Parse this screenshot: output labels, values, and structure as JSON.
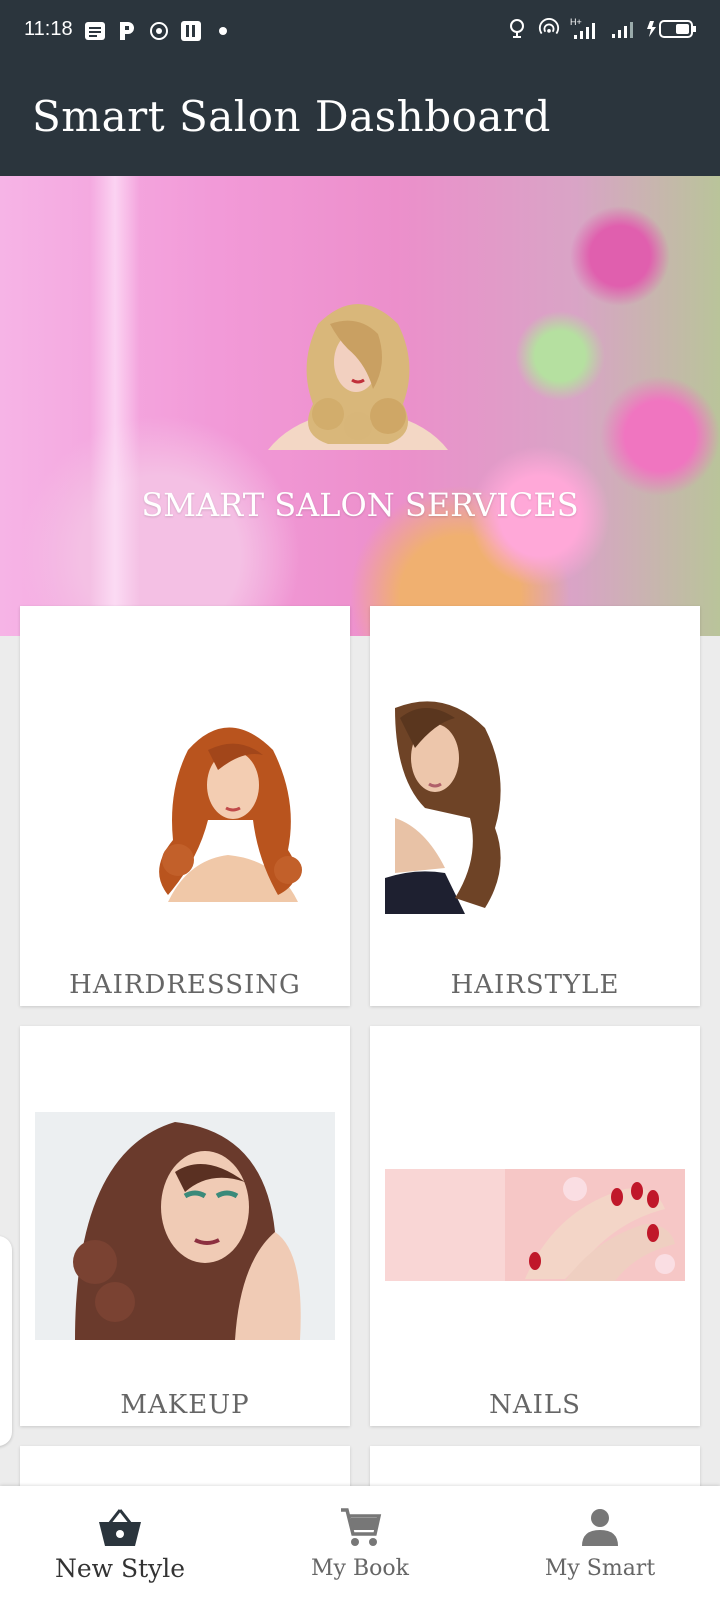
{
  "status_bar": {
    "time": "11:18",
    "left_icons": [
      "notes-icon",
      "parking-icon",
      "settings-app-icon",
      "parking-alt-icon",
      "dot-icon"
    ],
    "right_icons": [
      "alarm-icon",
      "hotspot-icon",
      "signal-icon",
      "signal-icon",
      "battery-icon"
    ],
    "network_label": "H+"
  },
  "app_bar": {
    "title": "Smart Salon Dashboard"
  },
  "banner": {
    "title": "SMART SALON SERVICES"
  },
  "services": [
    {
      "label": "HAIRDRESSING",
      "image": "redhead-woman-image"
    },
    {
      "label": "HAIRSTYLE",
      "image": "brunette-woman-image"
    },
    {
      "label": "MAKEUP",
      "image": "makeup-woman-image"
    },
    {
      "label": "NAILS",
      "image": "manicure-hands-image"
    }
  ],
  "bottom_nav": {
    "items": [
      {
        "label": "New Style",
        "icon": "basket-icon",
        "active": true
      },
      {
        "label": "My Book",
        "icon": "cart-icon",
        "active": false
      },
      {
        "label": "My Smart",
        "icon": "person-icon",
        "active": false
      }
    ]
  },
  "colors": {
    "app_bar": "#2b353d",
    "background": "#ececec",
    "card": "#ffffff",
    "label": "#666666"
  }
}
